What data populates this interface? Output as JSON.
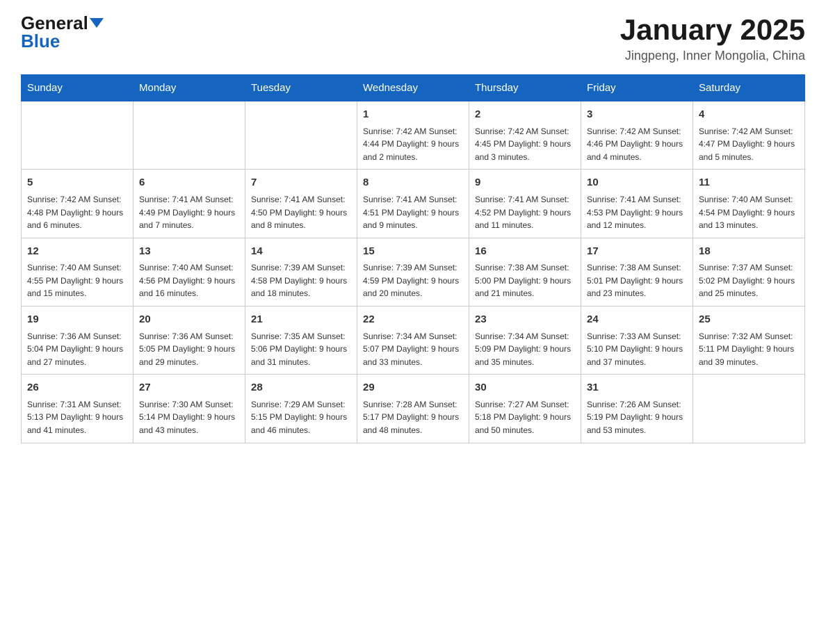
{
  "header": {
    "logo_general": "General",
    "logo_blue": "Blue",
    "title": "January 2025",
    "subtitle": "Jingpeng, Inner Mongolia, China"
  },
  "days_of_week": [
    "Sunday",
    "Monday",
    "Tuesday",
    "Wednesday",
    "Thursday",
    "Friday",
    "Saturday"
  ],
  "weeks": [
    [
      {
        "day": "",
        "info": ""
      },
      {
        "day": "",
        "info": ""
      },
      {
        "day": "",
        "info": ""
      },
      {
        "day": "1",
        "info": "Sunrise: 7:42 AM\nSunset: 4:44 PM\nDaylight: 9 hours and 2 minutes."
      },
      {
        "day": "2",
        "info": "Sunrise: 7:42 AM\nSunset: 4:45 PM\nDaylight: 9 hours and 3 minutes."
      },
      {
        "day": "3",
        "info": "Sunrise: 7:42 AM\nSunset: 4:46 PM\nDaylight: 9 hours and 4 minutes."
      },
      {
        "day": "4",
        "info": "Sunrise: 7:42 AM\nSunset: 4:47 PM\nDaylight: 9 hours and 5 minutes."
      }
    ],
    [
      {
        "day": "5",
        "info": "Sunrise: 7:42 AM\nSunset: 4:48 PM\nDaylight: 9 hours and 6 minutes."
      },
      {
        "day": "6",
        "info": "Sunrise: 7:41 AM\nSunset: 4:49 PM\nDaylight: 9 hours and 7 minutes."
      },
      {
        "day": "7",
        "info": "Sunrise: 7:41 AM\nSunset: 4:50 PM\nDaylight: 9 hours and 8 minutes."
      },
      {
        "day": "8",
        "info": "Sunrise: 7:41 AM\nSunset: 4:51 PM\nDaylight: 9 hours and 9 minutes."
      },
      {
        "day": "9",
        "info": "Sunrise: 7:41 AM\nSunset: 4:52 PM\nDaylight: 9 hours and 11 minutes."
      },
      {
        "day": "10",
        "info": "Sunrise: 7:41 AM\nSunset: 4:53 PM\nDaylight: 9 hours and 12 minutes."
      },
      {
        "day": "11",
        "info": "Sunrise: 7:40 AM\nSunset: 4:54 PM\nDaylight: 9 hours and 13 minutes."
      }
    ],
    [
      {
        "day": "12",
        "info": "Sunrise: 7:40 AM\nSunset: 4:55 PM\nDaylight: 9 hours and 15 minutes."
      },
      {
        "day": "13",
        "info": "Sunrise: 7:40 AM\nSunset: 4:56 PM\nDaylight: 9 hours and 16 minutes."
      },
      {
        "day": "14",
        "info": "Sunrise: 7:39 AM\nSunset: 4:58 PM\nDaylight: 9 hours and 18 minutes."
      },
      {
        "day": "15",
        "info": "Sunrise: 7:39 AM\nSunset: 4:59 PM\nDaylight: 9 hours and 20 minutes."
      },
      {
        "day": "16",
        "info": "Sunrise: 7:38 AM\nSunset: 5:00 PM\nDaylight: 9 hours and 21 minutes."
      },
      {
        "day": "17",
        "info": "Sunrise: 7:38 AM\nSunset: 5:01 PM\nDaylight: 9 hours and 23 minutes."
      },
      {
        "day": "18",
        "info": "Sunrise: 7:37 AM\nSunset: 5:02 PM\nDaylight: 9 hours and 25 minutes."
      }
    ],
    [
      {
        "day": "19",
        "info": "Sunrise: 7:36 AM\nSunset: 5:04 PM\nDaylight: 9 hours and 27 minutes."
      },
      {
        "day": "20",
        "info": "Sunrise: 7:36 AM\nSunset: 5:05 PM\nDaylight: 9 hours and 29 minutes."
      },
      {
        "day": "21",
        "info": "Sunrise: 7:35 AM\nSunset: 5:06 PM\nDaylight: 9 hours and 31 minutes."
      },
      {
        "day": "22",
        "info": "Sunrise: 7:34 AM\nSunset: 5:07 PM\nDaylight: 9 hours and 33 minutes."
      },
      {
        "day": "23",
        "info": "Sunrise: 7:34 AM\nSunset: 5:09 PM\nDaylight: 9 hours and 35 minutes."
      },
      {
        "day": "24",
        "info": "Sunrise: 7:33 AM\nSunset: 5:10 PM\nDaylight: 9 hours and 37 minutes."
      },
      {
        "day": "25",
        "info": "Sunrise: 7:32 AM\nSunset: 5:11 PM\nDaylight: 9 hours and 39 minutes."
      }
    ],
    [
      {
        "day": "26",
        "info": "Sunrise: 7:31 AM\nSunset: 5:13 PM\nDaylight: 9 hours and 41 minutes."
      },
      {
        "day": "27",
        "info": "Sunrise: 7:30 AM\nSunset: 5:14 PM\nDaylight: 9 hours and 43 minutes."
      },
      {
        "day": "28",
        "info": "Sunrise: 7:29 AM\nSunset: 5:15 PM\nDaylight: 9 hours and 46 minutes."
      },
      {
        "day": "29",
        "info": "Sunrise: 7:28 AM\nSunset: 5:17 PM\nDaylight: 9 hours and 48 minutes."
      },
      {
        "day": "30",
        "info": "Sunrise: 7:27 AM\nSunset: 5:18 PM\nDaylight: 9 hours and 50 minutes."
      },
      {
        "day": "31",
        "info": "Sunrise: 7:26 AM\nSunset: 5:19 PM\nDaylight: 9 hours and 53 minutes."
      },
      {
        "day": "",
        "info": ""
      }
    ]
  ]
}
